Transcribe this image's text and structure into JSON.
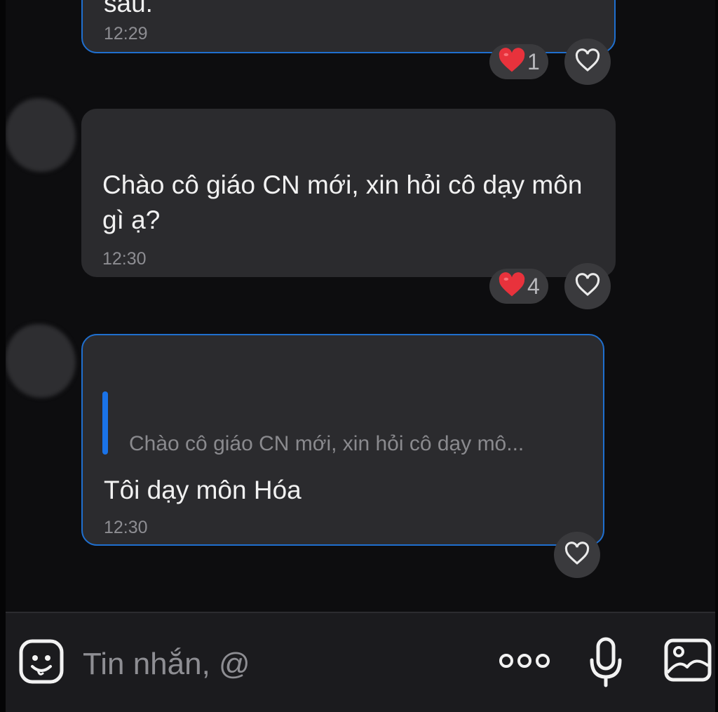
{
  "messages": [
    {
      "text": "sau.",
      "time": "12:29",
      "reaction": {
        "emoji": "heart",
        "count": "1"
      }
    },
    {
      "text": "Chào cô giáo CN mới, xin hỏi cô dạy môn gì ạ?",
      "time": "12:30",
      "reaction": {
        "emoji": "heart",
        "count": "4"
      }
    },
    {
      "quote": "Chào cô giáo CN mới, xin hỏi cô dạy mô...",
      "text": "Tôi dạy môn Hóa",
      "time": "12:30"
    }
  ],
  "composer": {
    "placeholder": "Tin nhắn, @",
    "icons": [
      "sticker-icon",
      "more-icon",
      "microphone-icon",
      "image-icon"
    ]
  },
  "colors": {
    "background": "#0d0d0f",
    "bubble": "#2b2b2e",
    "highlight_border": "#1f6fcf",
    "quote_bar": "#1a73e8",
    "heart": "#e8323c"
  }
}
